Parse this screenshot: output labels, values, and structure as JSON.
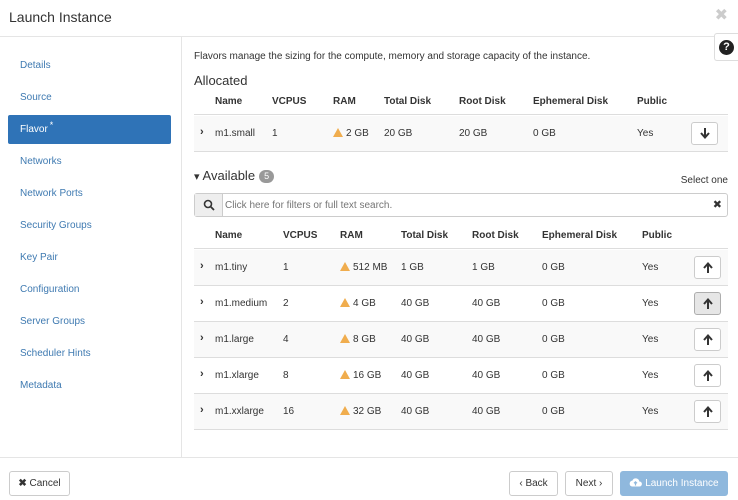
{
  "dialog": {
    "title": "Launch Instance",
    "close_glyph": "✖",
    "help_glyph": "?"
  },
  "sidebar": {
    "items": [
      {
        "label": "Details"
      },
      {
        "label": "Source"
      },
      {
        "label": "Flavor",
        "required_mark": "*",
        "active": true
      },
      {
        "label": "Networks"
      },
      {
        "label": "Network Ports"
      },
      {
        "label": "Security Groups"
      },
      {
        "label": "Key Pair"
      },
      {
        "label": "Configuration"
      },
      {
        "label": "Server Groups"
      },
      {
        "label": "Scheduler Hints"
      },
      {
        "label": "Metadata"
      }
    ]
  },
  "main": {
    "description": "Flavors manage the sizing for the compute, memory and storage capacity of the instance.",
    "allocated_heading": "Allocated",
    "available_heading": "Available",
    "available_count": "5",
    "select_hint": "Select one",
    "search": {
      "placeholder": "Click here for filters or full text search.",
      "value": ""
    },
    "columns": [
      "Name",
      "VCPUS",
      "RAM",
      "Total Disk",
      "Root Disk",
      "Ephemeral Disk",
      "Public"
    ],
    "allocated_rows": [
      {
        "name": "m1.small",
        "vcpus": "1",
        "ram": "2 GB",
        "total_disk": "20 GB",
        "root_disk": "20 GB",
        "ephemeral_disk": "0 GB",
        "public": "Yes"
      }
    ],
    "available_rows": [
      {
        "name": "m1.tiny",
        "vcpus": "1",
        "ram": "512 MB",
        "total_disk": "1 GB",
        "root_disk": "1 GB",
        "ephemeral_disk": "0 GB",
        "public": "Yes"
      },
      {
        "name": "m1.medium",
        "vcpus": "2",
        "ram": "4 GB",
        "total_disk": "40 GB",
        "root_disk": "40 GB",
        "ephemeral_disk": "0 GB",
        "public": "Yes"
      },
      {
        "name": "m1.large",
        "vcpus": "4",
        "ram": "8 GB",
        "total_disk": "40 GB",
        "root_disk": "40 GB",
        "ephemeral_disk": "0 GB",
        "public": "Yes"
      },
      {
        "name": "m1.xlarge",
        "vcpus": "8",
        "ram": "16 GB",
        "total_disk": "40 GB",
        "root_disk": "40 GB",
        "ephemeral_disk": "0 GB",
        "public": "Yes"
      },
      {
        "name": "m1.xxlarge",
        "vcpus": "16",
        "ram": "32 GB",
        "total_disk": "40 GB",
        "root_disk": "40 GB",
        "ephemeral_disk": "0 GB",
        "public": "Yes"
      }
    ]
  },
  "footer": {
    "cancel_label": "Cancel",
    "back_label": "Back",
    "next_label": "Next",
    "launch_label": "Launch Instance"
  },
  "icons": {
    "row_expand": "chevron-right-icon",
    "ram_warning": "warning-triangle-icon",
    "deallocate": "arrow-down-icon",
    "allocate": "arrow-up-icon",
    "search": "search-icon",
    "clear_search": "close-icon",
    "launch": "cloud-upload-icon"
  },
  "colors": {
    "accent": "#2f73b7",
    "link": "#3f7ab1",
    "warning": "#f0ad4e",
    "launch_disabled": "#8fb8dd"
  }
}
